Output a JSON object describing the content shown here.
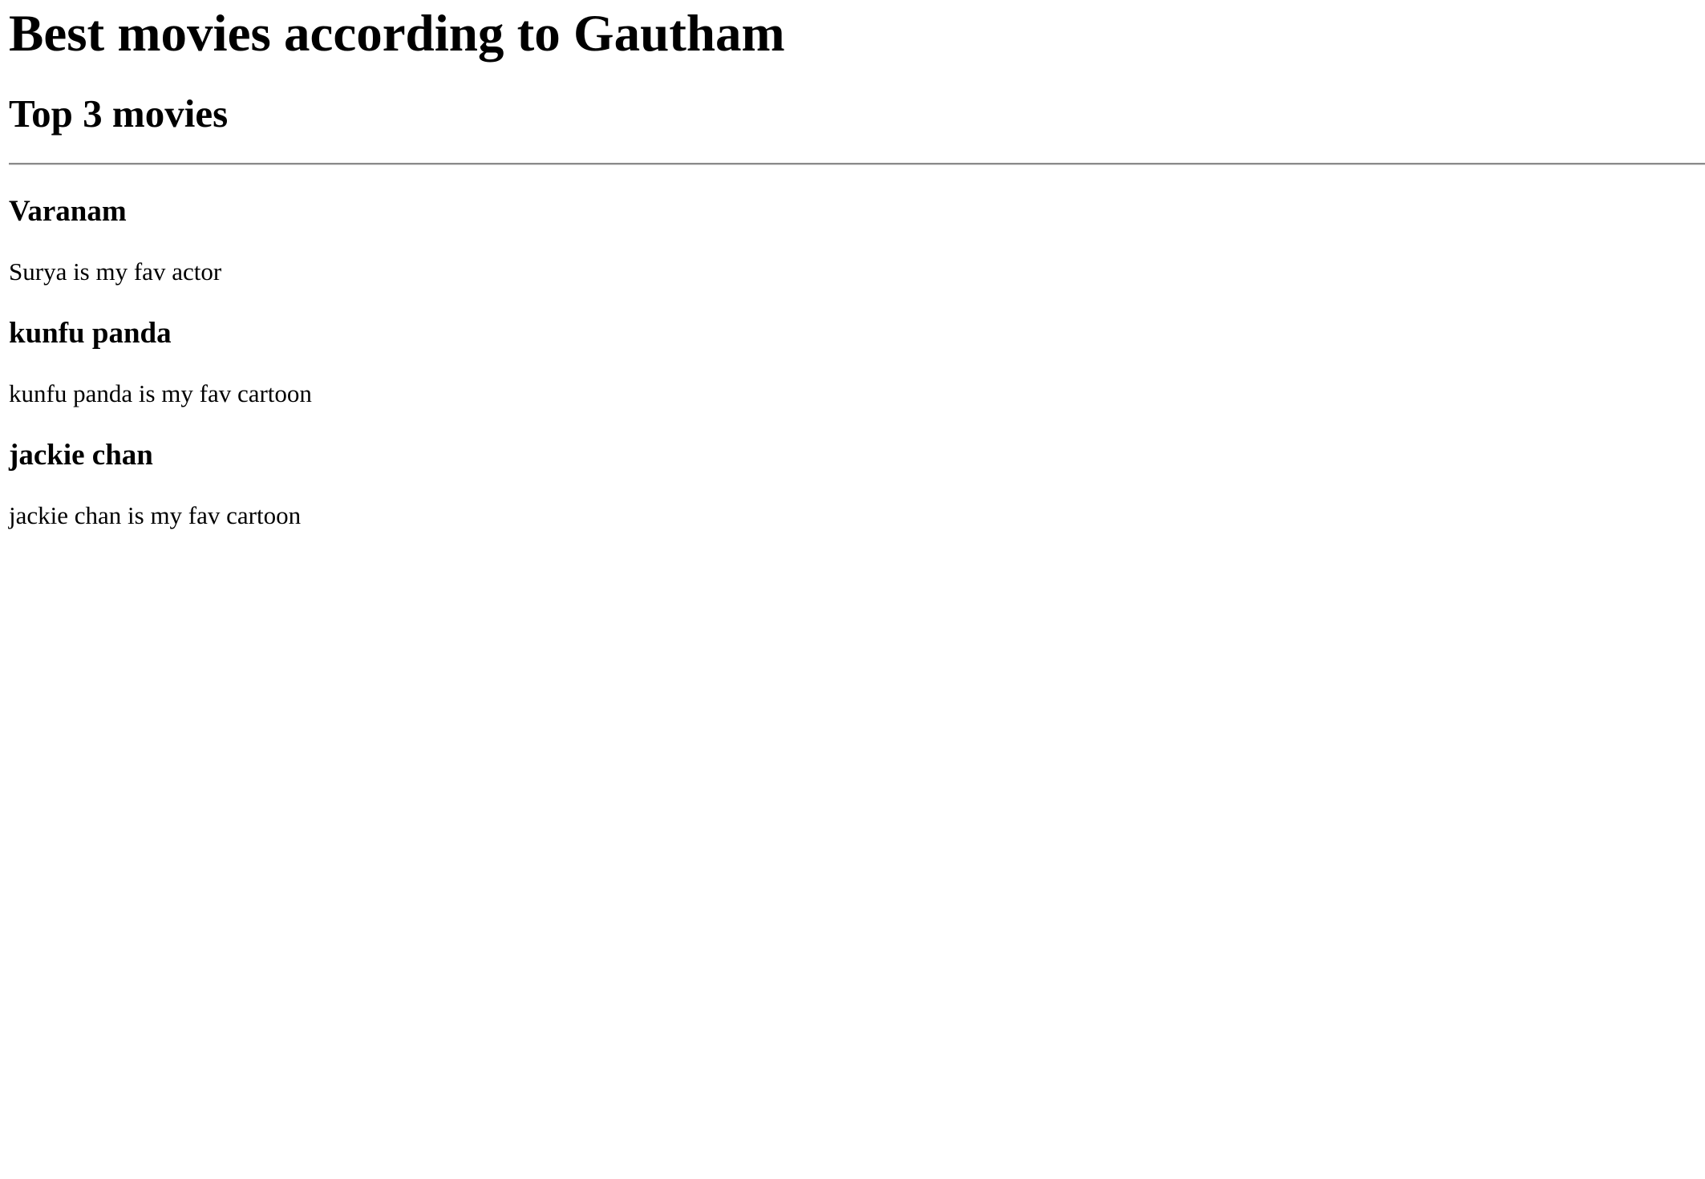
{
  "page": {
    "title": "Best movies according to Gautham",
    "subtitle": "Top 3 movies"
  },
  "movies": [
    {
      "title": "Varanam",
      "description": "Surya is my fav actor"
    },
    {
      "title": "kunfu panda",
      "description": "kunfu panda is my fav cartoon"
    },
    {
      "title": "jackie chan",
      "description": "jackie chan is my fav cartoon"
    }
  ]
}
